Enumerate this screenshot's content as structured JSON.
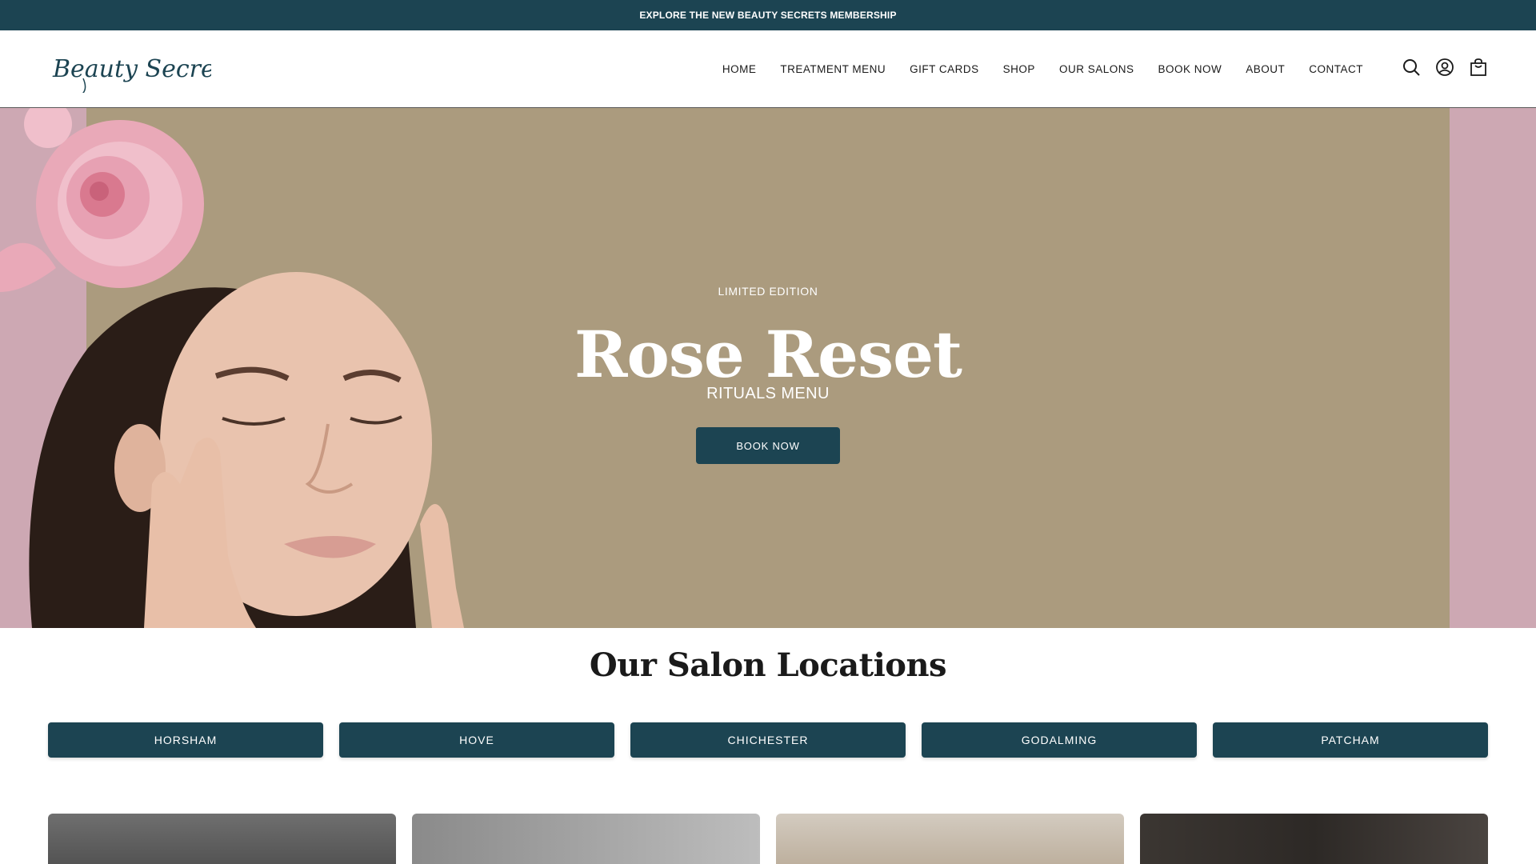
{
  "announcement": {
    "text": "EXPLORE THE NEW BEAUTY SECRETS MEMBERSHIP"
  },
  "header": {
    "logo_text": "Beauty Secrets",
    "nav": [
      {
        "label": "HOME"
      },
      {
        "label": "TREATMENT MENU"
      },
      {
        "label": "GIFT CARDS"
      },
      {
        "label": "SHOP"
      },
      {
        "label": "OUR SALONS"
      },
      {
        "label": "BOOK NOW"
      },
      {
        "label": "ABOUT"
      },
      {
        "label": "CONTACT"
      }
    ],
    "icons": [
      "search-icon",
      "account-icon",
      "bag-icon"
    ]
  },
  "hero": {
    "eyebrow": "LIMITED EDITION",
    "title": "Rose Reset",
    "subtitle": "RITUALS MENU",
    "cta": "BOOK NOW"
  },
  "locations": {
    "title": "Our Salon Locations",
    "buttons": [
      {
        "label": "HORSHAM"
      },
      {
        "label": "HOVE"
      },
      {
        "label": "CHICHESTER"
      },
      {
        "label": "GODALMING"
      },
      {
        "label": "PATCHAM"
      }
    ]
  },
  "colors": {
    "brand_teal": "#1c4452",
    "hero_tan": "#ab9b7e",
    "hero_pink": "#cda8b3"
  }
}
